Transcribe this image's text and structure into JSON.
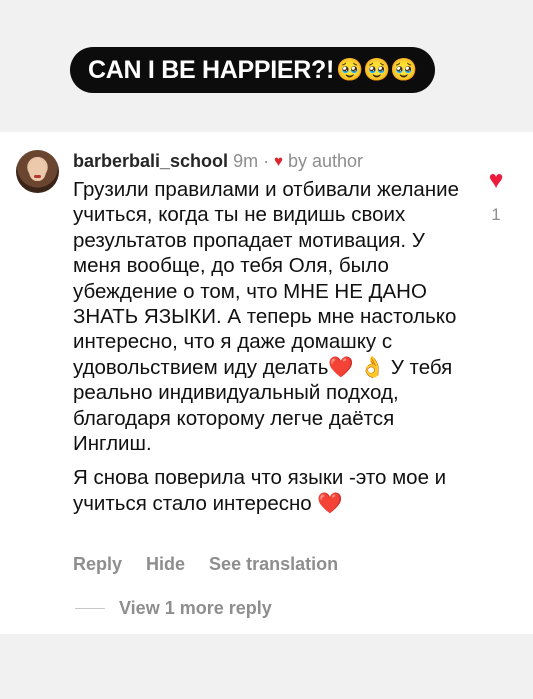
{
  "story": {
    "headline": "CAN I BE HAPPIER?!",
    "headline_emoji": "🥹🥹🥹"
  },
  "comment": {
    "username": "barberbali_school",
    "time": "9m",
    "separator": "·",
    "author_like_icon": "heart-icon",
    "author_like_text": "by author",
    "paragraphs": [
      "Грузили правилами и отбивали желание учиться, когда ты не видишь своих результатов пропадает мотивация. У меня вообще, до тебя Оля, было убеждение о том, что МНЕ НЕ ДАНО ЗНАТЬ ЯЗЫКИ. А теперь мне настолько интересно, что я даже домашку с удовольствием иду делать❤️ 👌 У тебя реально индивидуальный подход, благодаря которому легче даётся Инглиш.",
      "Я снова поверила что языки -это мое и учиться стало интересно ❤️"
    ],
    "like_icon": "heart-icon",
    "like_count": "1",
    "actions": {
      "reply": "Reply",
      "hide": "Hide",
      "translate": "See translation"
    },
    "view_more": "View 1 more reply"
  },
  "colors": {
    "like_red": "#ed1c3c",
    "muted_text": "#8e8e8e",
    "headline_bg": "#0c0c0c"
  }
}
